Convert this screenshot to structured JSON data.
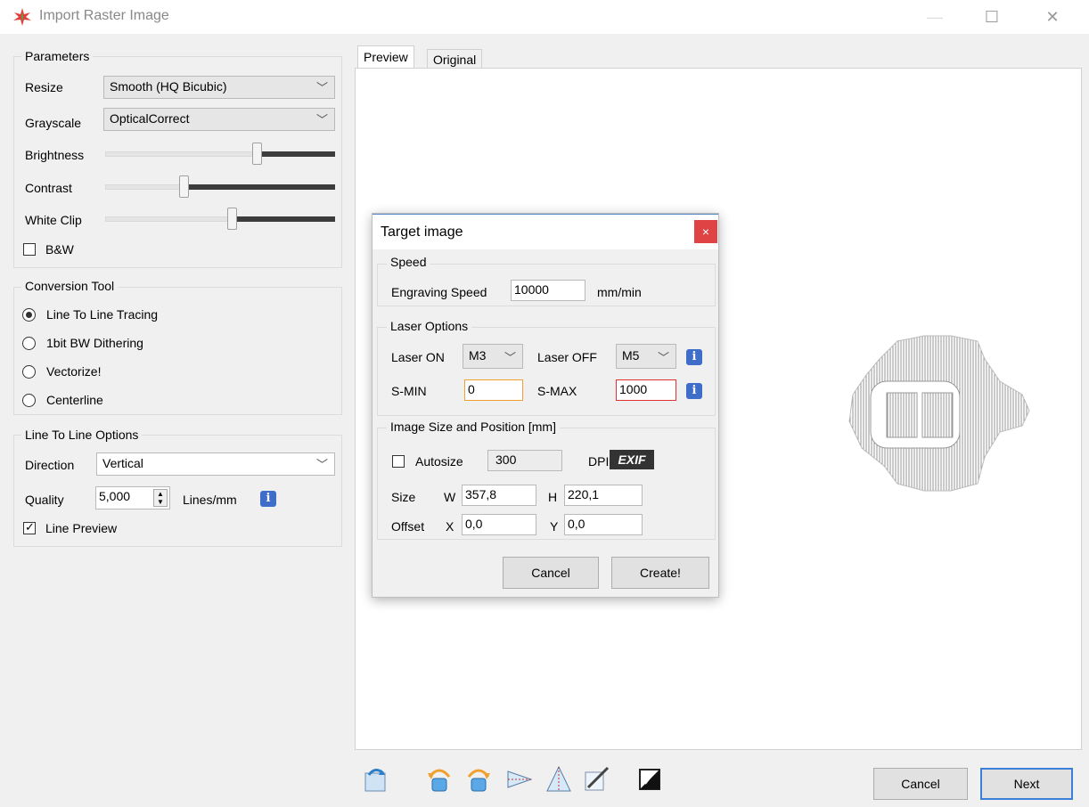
{
  "window": {
    "title": "Import Raster Image",
    "minimize_glyph": "—",
    "maximize_glyph": "☐",
    "close_glyph": "✕"
  },
  "parameters": {
    "title": "Parameters",
    "resize_label": "Resize",
    "resize_value": "Smooth (HQ Bicubic)",
    "grayscale_label": "Grayscale",
    "grayscale_value": "OpticalCorrect",
    "brightness_label": "Brightness",
    "brightness_level": 0.66,
    "contrast_label": "Contrast",
    "contrast_level": 0.34,
    "whiteclip_label": "White Clip",
    "whiteclip_level": 0.55,
    "bw_label": "B&W",
    "bw_checked": false
  },
  "conversion_tool": {
    "title": "Conversion Tool",
    "options": [
      {
        "label": "Line To Line Tracing",
        "selected": true
      },
      {
        "label": "1bit BW Dithering",
        "selected": false
      },
      {
        "label": "Vectorize!",
        "selected": false
      },
      {
        "label": "Centerline",
        "selected": false
      }
    ]
  },
  "line_options": {
    "title": "Line To Line Options",
    "direction_label": "Direction",
    "direction_value": "Vertical",
    "quality_label": "Quality",
    "quality_value": "5,000",
    "quality_unit": "Lines/mm",
    "line_preview_label": "Line Preview",
    "line_preview_checked": true
  },
  "tabs": {
    "preview": "Preview",
    "original": "Original",
    "active": "Preview"
  },
  "dialog": {
    "title": "Target image",
    "close_glyph": "×",
    "speed_title": "Speed",
    "engraving_speed_label": "Engraving Speed",
    "engraving_speed_value": "10000",
    "speed_unit": "mm/min",
    "laser_title": "Laser Options",
    "laser_on_label": "Laser ON",
    "laser_on_value": "M3",
    "laser_off_label": "Laser OFF",
    "laser_off_value": "M5",
    "smin_label": "S-MIN",
    "smin_value": "0",
    "smax_label": "S-MAX",
    "smax_value": "1000",
    "size_title": "Image Size and Position [mm]",
    "autosize_label": "Autosize",
    "autosize_checked": false,
    "dpi_value": "300",
    "dpi_label": "DPI",
    "exif_label": "EXIF",
    "size_label": "Size",
    "w_label": "W",
    "w_value": "357,8",
    "h_label": "H",
    "h_value": "220,1",
    "offset_label": "Offset",
    "x_label": "X",
    "x_value": "0,0",
    "y_label": "Y",
    "y_value": "0,0",
    "cancel_label": "Cancel",
    "create_label": "Create!"
  },
  "footer": {
    "cancel_label": "Cancel",
    "next_label": "Next",
    "info_glyph": "i",
    "tools": [
      "reload-icon",
      "rotate-ccw-icon",
      "rotate-cw-icon",
      "flip-horizontal-icon",
      "flip-vertical-icon",
      "crop-icon",
      "invert-icon"
    ]
  },
  "colors": {
    "accent": "#3c7fd6",
    "close_red": "#e04343",
    "info_blue": "#3e6ec9",
    "smin_border": "#f0a030",
    "smax_border": "#e03030"
  }
}
